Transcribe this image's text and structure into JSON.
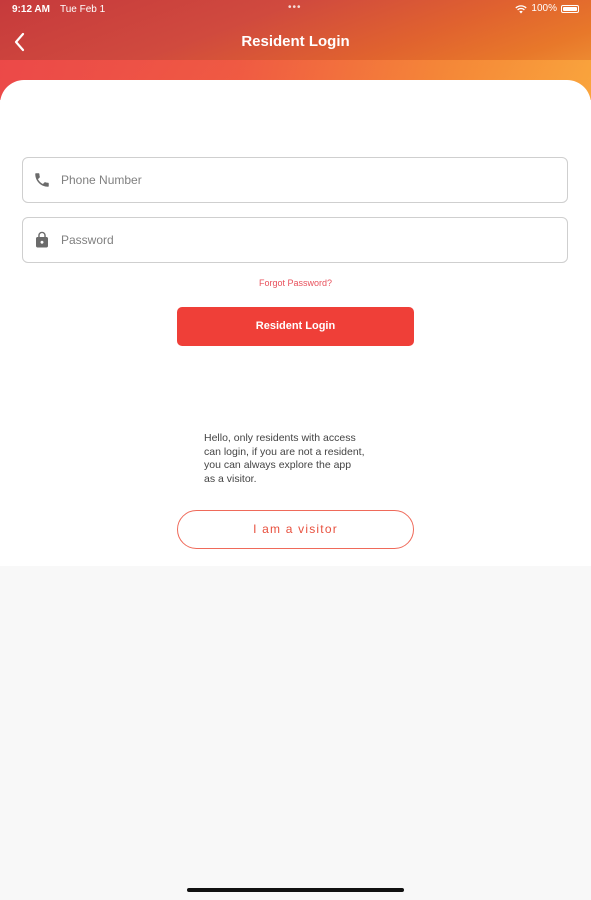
{
  "status_bar": {
    "time": "9:12 AM",
    "date": "Tue Feb 1",
    "dots": "•••",
    "battery": "100%"
  },
  "header": {
    "title": "Resident Login"
  },
  "form": {
    "phone_placeholder": "Phone Number",
    "password_placeholder": "Password",
    "forgot_password": "Forgot Password?",
    "login_label": "Resident Login"
  },
  "info": {
    "message": "Hello, only residents with access\ncan login, if you are not a resident,\nyou can always explore the app\nas a visitor."
  },
  "visitor": {
    "label": "I am a visitor"
  },
  "icons": {
    "back": "chevron-left-icon",
    "phone": "phone-icon",
    "lock": "lock-icon",
    "wifi": "wifi-icon",
    "battery": "battery-icon"
  },
  "colors": {
    "accent": "#ef3f38",
    "header_start": "#c63a3c",
    "header_end": "#f3a03a",
    "link": "#e8505b"
  }
}
